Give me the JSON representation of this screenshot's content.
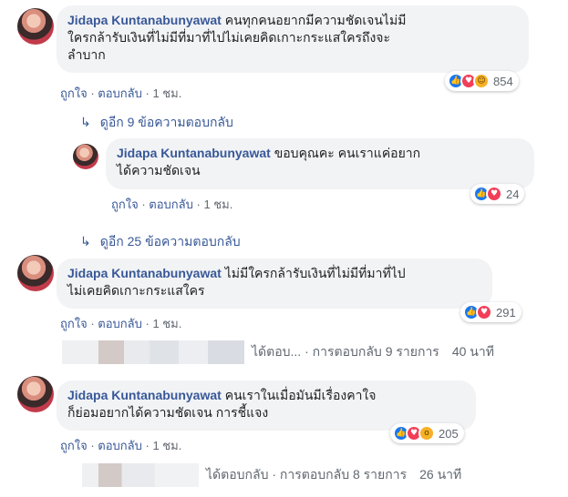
{
  "comments": [
    {
      "author": "Jidapa Kuntanabunyawat",
      "line1": "คนทุกคนอยากมีความชัดเจนไม่มี",
      "line2": "ใครกล้ารับเงินที่ไม่มีที่มาที่ไปไม่เคยคิดเกาะกระแสใครถึงจะ",
      "line3": "ลำบาก",
      "like": "ถูกใจ",
      "reply": "ตอบกลับ",
      "time": "1 ชม.",
      "reaction_count": "854",
      "more_replies": "ดูอีก 9 ข้อความตอบกลับ"
    },
    {
      "author": "Jidapa Kuntanabunyawat",
      "line1": "ขอบคุณคะ คนเราแค่อยาก",
      "line2": "ได้ความชัดเจน",
      "like": "ถูกใจ",
      "reply": "ตอบกลับ",
      "time": "1 ชม.",
      "reaction_count": "24",
      "more_replies": "ดูอีก 25 ข้อความตอบกลับ"
    },
    {
      "author": "Jidapa Kuntanabunyawat",
      "line1": "ไม่มีใครกล้ารับเงินที่ไม่มีที่มาที่ไป",
      "line2": "ไม่เคยคิดเกาะกระแสใคร",
      "like": "ถูกใจ",
      "reply": "ตอบกลับ",
      "time": "1 ชม.",
      "reaction_count": "291",
      "collapsed_text": "ได้ตอบ... · การตอบกลับ 9 รายการ",
      "collapsed_time": "40 นาที"
    },
    {
      "author": "Jidapa Kuntanabunyawat",
      "line1": "คนเราในเมื่อมันมีเรื่องคาใจ",
      "line2": "ก็ย่อมอยากได้ความชัดเจน การชี้แจง",
      "like": "ถูกใจ",
      "reply": "ตอบกลับ",
      "time": "1 ชม.",
      "reaction_count": "205",
      "collapsed_text": "ได้ตอบกลับ · การตอบกลับ 8 รายการ",
      "collapsed_time": "26 นาที"
    }
  ],
  "colors": {
    "author": "#385898",
    "bubble": "#f2f3f5",
    "like_reaction": "#1877f2",
    "love_reaction": "#f33e58",
    "haha_reaction": "#f7b125"
  },
  "icons": {
    "reply_arrow": "reply-arrow-icon",
    "like": "like-reaction-icon",
    "love": "love-reaction-icon",
    "haha": "haha-reaction-icon",
    "wow": "wow-reaction-icon"
  }
}
